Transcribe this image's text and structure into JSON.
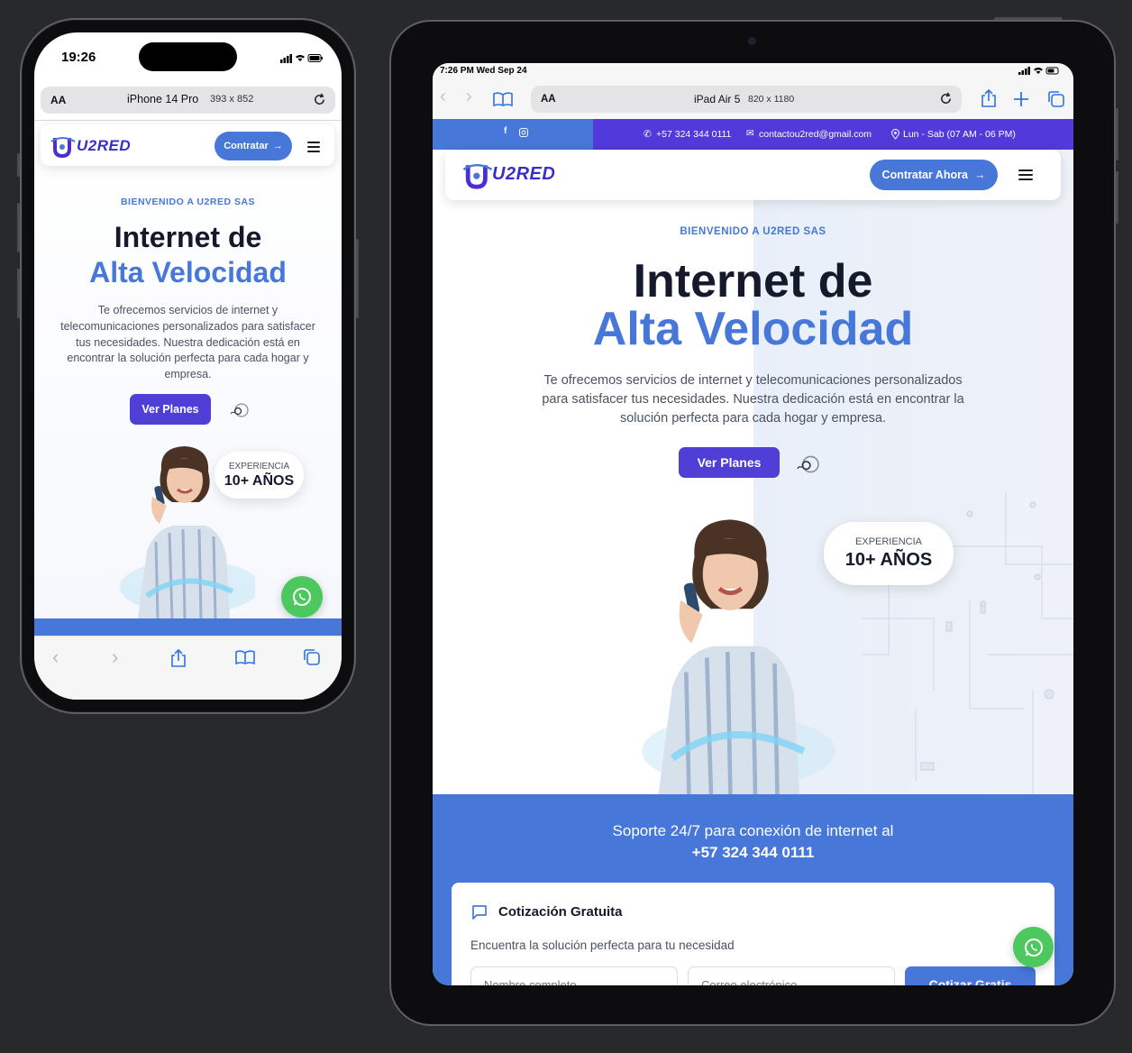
{
  "phone": {
    "status_time": "19:26",
    "url_aa": "AA",
    "url_text": "iPhone 14 Pro",
    "url_dims": "393 x 852",
    "nav_button": "Contratar",
    "logo_text": "U2RED",
    "eyebrow": "BIENVENIDO A U2RED SAS",
    "title_line1": "Internet de",
    "title_line2": "Alta Velocidad",
    "description": "Te ofrecemos servicios de internet y telecomunicaciones personalizados para satisfacer tus necesidades. Nuestra dedicación está en encontrar la solución perfecta para cada hogar y empresa.",
    "cta": "Ver Planes",
    "badge_label": "EXPERIENCIA",
    "badge_value": "10+ AÑOS"
  },
  "tablet": {
    "status_time": "7:26 PM  Wed Sep 24",
    "url_aa": "AA",
    "url_text": "iPad Air 5",
    "url_dims": "820 x 1180",
    "topbar": {
      "phone": "+57 324 344 0111",
      "email": "contactou2red@gmail.com",
      "hours": "Lun - Sab (07 AM - 06 PM)"
    },
    "nav_button": "Contratar Ahora",
    "logo_text": "U2RED",
    "eyebrow": "BIENVENIDO A U2RED SAS",
    "title_line1": "Internet de",
    "title_line2": "Alta Velocidad",
    "description": "Te ofrecemos servicios de internet y telecomunicaciones personalizados para satisfacer tus necesidades. Nuestra dedicación está en encontrar la solución perfecta para cada hogar y empresa.",
    "cta": "Ver Planes",
    "badge_label": "EXPERIENCIA",
    "badge_value": "10+ AÑOS",
    "support_line1": "Soporte 24/7 para conexión de internet al",
    "support_line2": "+57 324 344 0111",
    "quote_title": "Cotización Gratuita",
    "quote_sub": "Encuentra la solución perfecta para tu necesidad",
    "name_placeholder": "Nombre completo",
    "email_placeholder": "Correo electrónico",
    "quote_button": "Cotizar Gratis"
  },
  "colors": {
    "brand_blue": "#4677d9",
    "brand_purple": "#4f3fd6",
    "whatsapp_green": "#4cc85e"
  }
}
